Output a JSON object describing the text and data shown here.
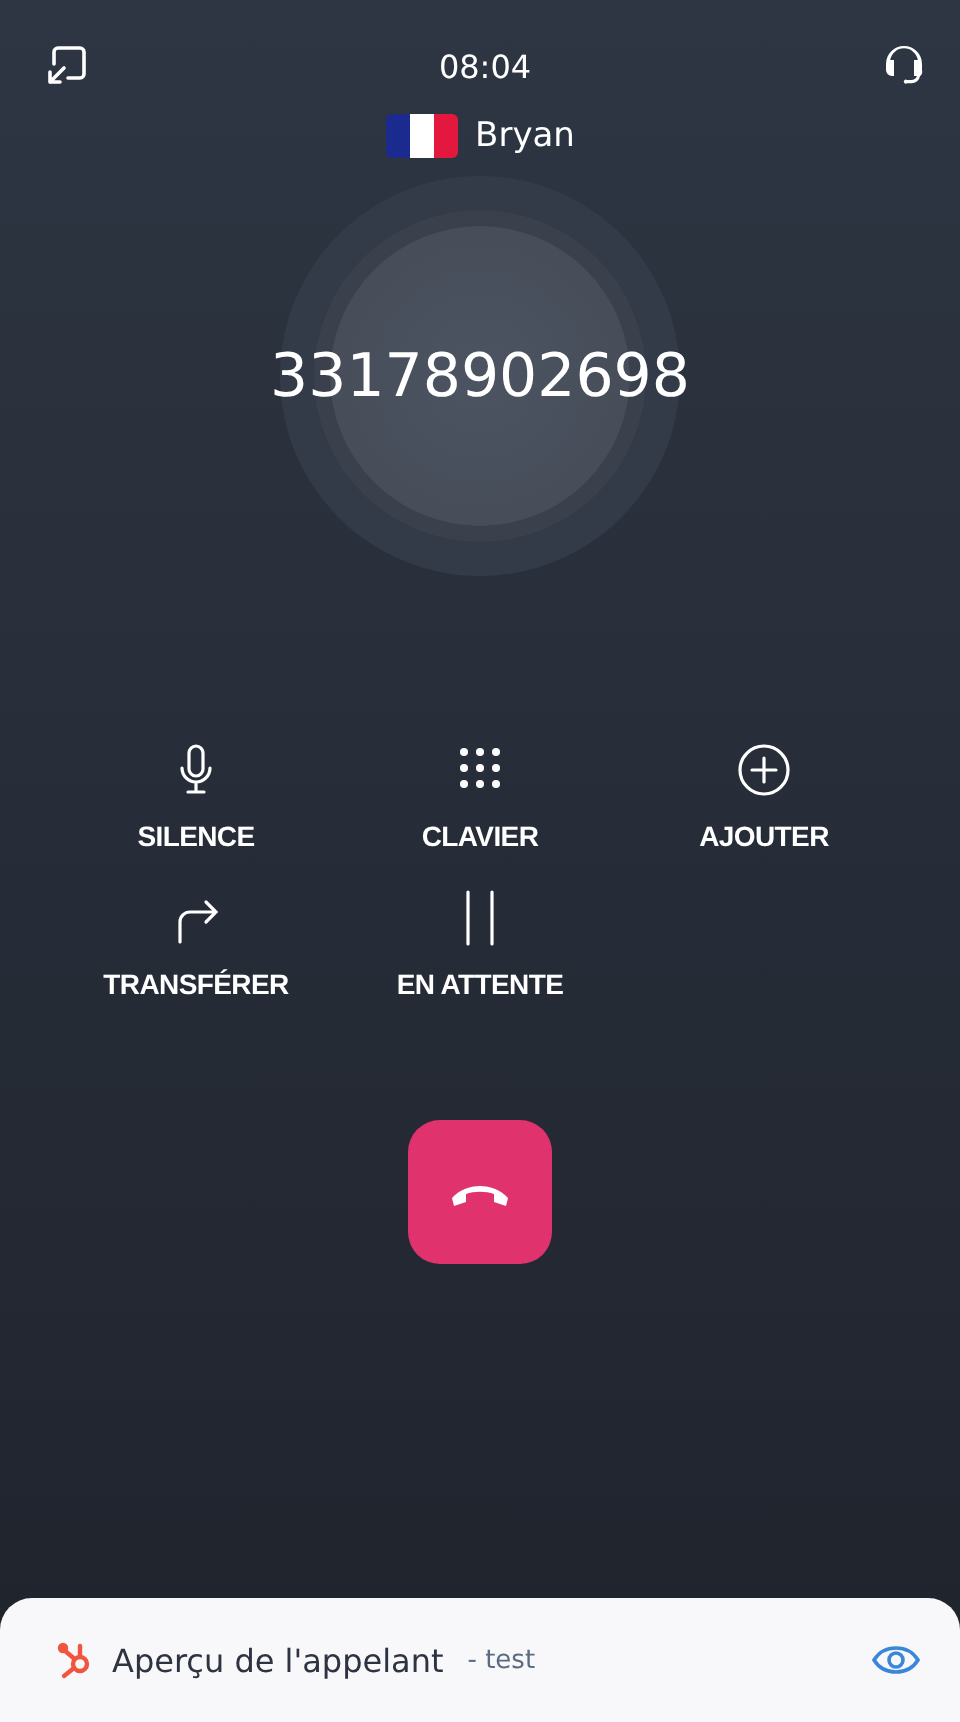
{
  "header": {
    "timer": "08:04"
  },
  "caller": {
    "name": "Bryan",
    "number": "33178902698"
  },
  "actions": [
    {
      "kind": "mic",
      "label": "SILENCE"
    },
    {
      "kind": "keypad",
      "label": "CLAVIER"
    },
    {
      "kind": "add",
      "label": "AJOUTER"
    },
    {
      "kind": "transfer",
      "label": "TRANSFÉRER"
    },
    {
      "kind": "hold",
      "label": "EN ATTENTE"
    }
  ],
  "preview": {
    "title": "Aperçu de l'appelant",
    "subtitle": "- test"
  }
}
